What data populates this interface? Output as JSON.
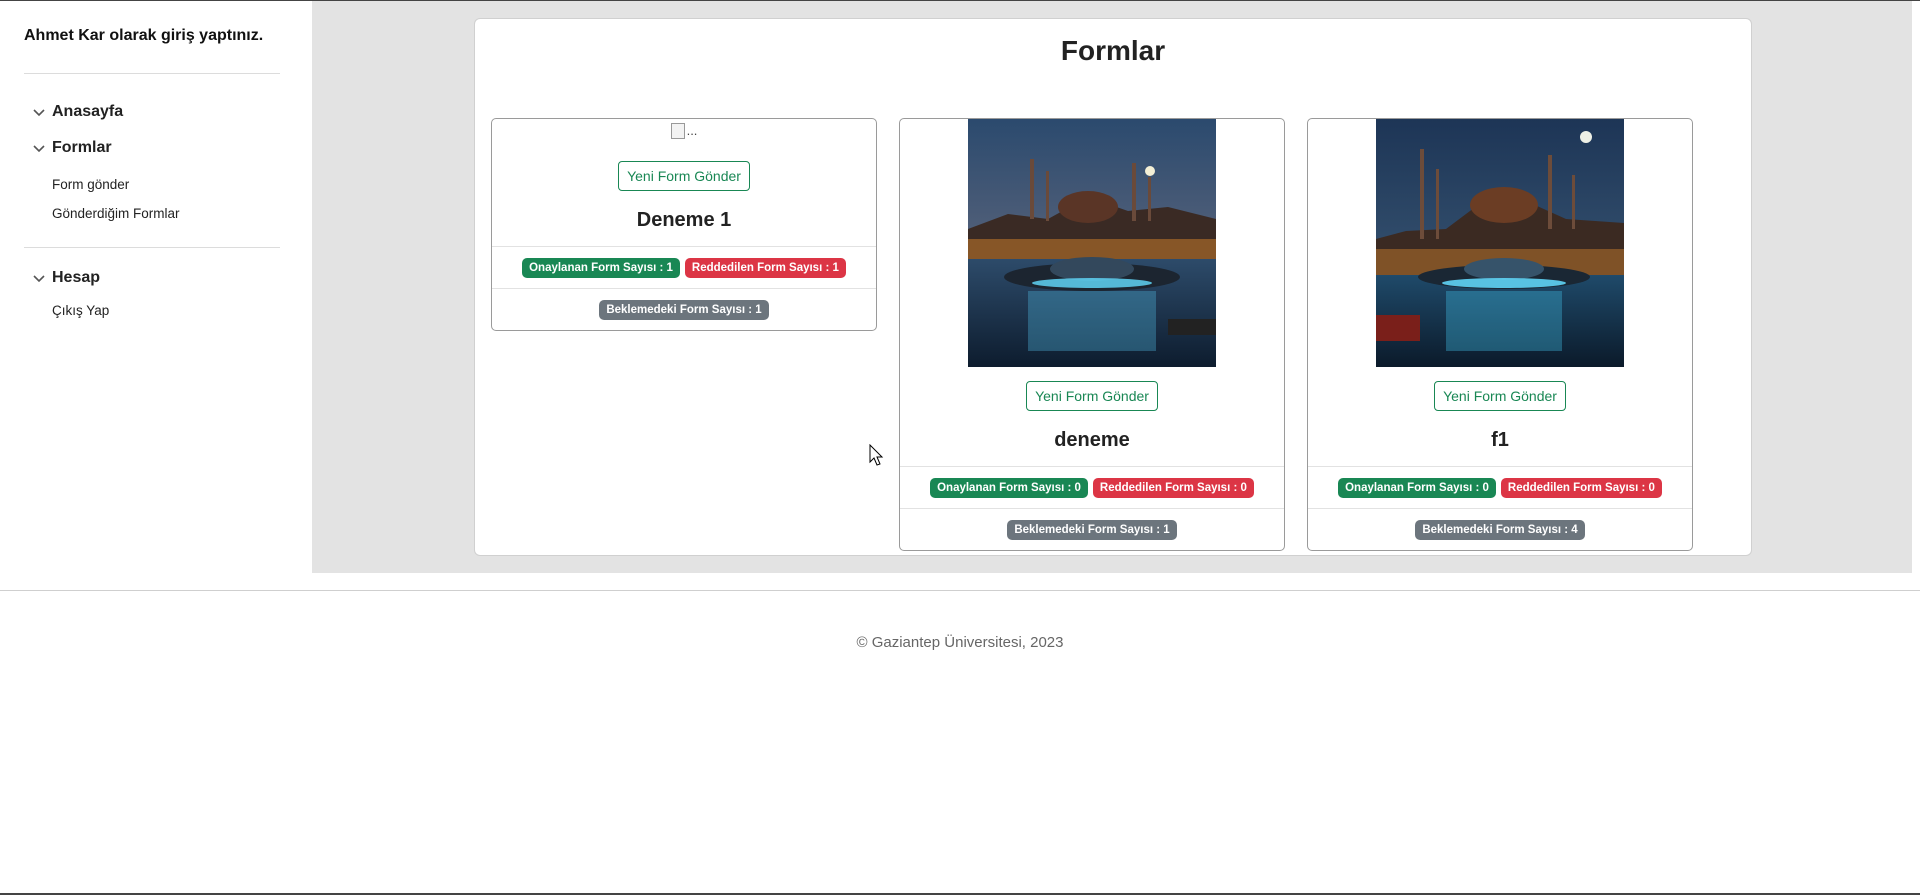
{
  "sidebar": {
    "welcome": "Ahmet Kar olarak giriş yaptınız.",
    "groups": [
      {
        "label": "Anasayfa",
        "icon": "chevron-down-icon",
        "links": []
      },
      {
        "label": "Formlar",
        "icon": "chevron-down-icon",
        "links": [
          "Form gönder",
          "Gönderdiğim Formlar"
        ]
      },
      {
        "label": "Hesap",
        "icon": "chevron-down-icon",
        "links": [
          "Çıkış Yap"
        ]
      }
    ]
  },
  "main": {
    "title": "Formlar",
    "cards": [
      {
        "title": "Deneme 1",
        "image_alt": "...",
        "image": "broken-image",
        "button_label": "Yeni Form Gönder",
        "approved": "Onaylanan Form Sayısı : 1",
        "rejected": "Reddedilen Form Sayısı : 1",
        "pending": "Beklemedeki Form Sayısı : 1"
      },
      {
        "title": "deneme",
        "image": "istanbul-ufo-scene",
        "button_label": "Yeni Form Gönder",
        "approved": "Onaylanan Form Sayısı : 0",
        "rejected": "Reddedilen Form Sayısı : 0",
        "pending": "Beklemedeki Form Sayısı : 1"
      },
      {
        "title": "f1",
        "image": "istanbul-ufo-scene",
        "button_label": "Yeni Form Gönder",
        "approved": "Onaylanan Form Sayısı : 0",
        "rejected": "Reddedilen Form Sayısı : 0",
        "pending": "Beklemedeki Form Sayısı : 4"
      }
    ]
  },
  "footer": {
    "text": "© Gaziantep Üniversitesi, 2023"
  },
  "colors": {
    "success": "#198754",
    "danger": "#dc3545",
    "secondary": "#6c757d",
    "content_bg": "#e3e3e3"
  }
}
